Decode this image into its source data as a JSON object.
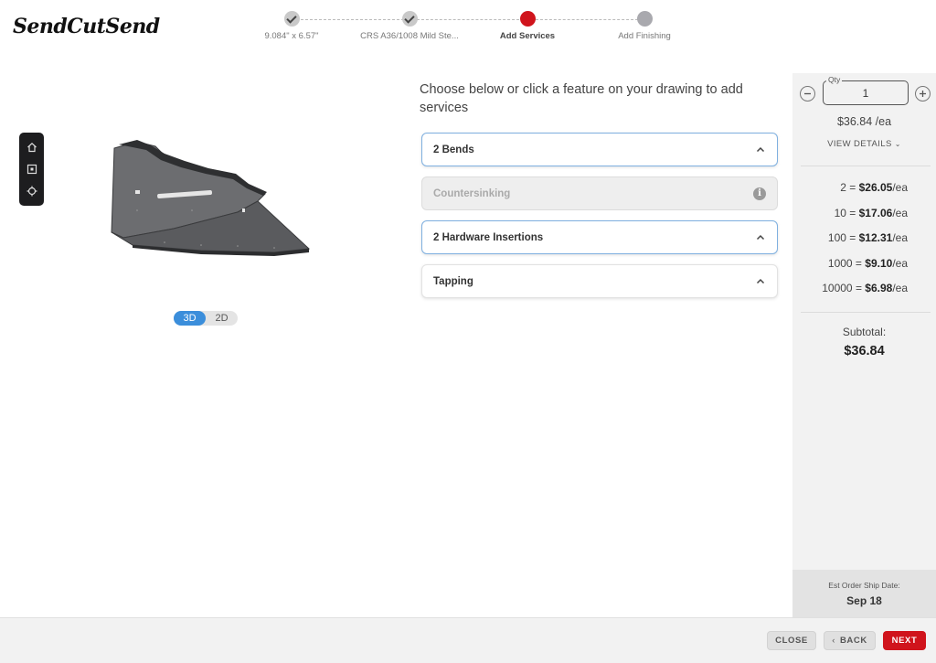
{
  "header": {
    "logo": "SendCutSend",
    "steps": [
      {
        "label": "9.084\" x 6.57\"",
        "state": "done"
      },
      {
        "label": "CRS A36/1008 Mild Ste...",
        "state": "done"
      },
      {
        "label": "Add Services",
        "state": "active"
      },
      {
        "label": "Add Finishing",
        "state": "todo"
      }
    ]
  },
  "viewer": {
    "toolbar": [
      "home-icon",
      "cube-front-icon",
      "fit-view-icon"
    ],
    "toggle": {
      "three_d": "3D",
      "two_d": "2D",
      "selected": "3D"
    }
  },
  "services": {
    "prompt": "Choose below or click a feature on your drawing to add services",
    "items": [
      {
        "label": "2 Bends",
        "state": "selected",
        "icon": "chevron-up-icon"
      },
      {
        "label": "Countersinking",
        "state": "disabled",
        "icon": "info-icon"
      },
      {
        "label": "2 Hardware Insertions",
        "state": "selected",
        "icon": "chevron-up-icon"
      },
      {
        "label": "Tapping",
        "state": "available",
        "icon": "chevron-up-icon"
      }
    ]
  },
  "pricing": {
    "qty_label": "Qty",
    "qty_value": "1",
    "unit_price": "$36.84 /ea",
    "view_details": "VIEW DETAILS",
    "tiers": [
      {
        "qty": "2 = ",
        "price": "$26.05",
        "unit": "/ea"
      },
      {
        "qty": "10 = ",
        "price": "$17.06",
        "unit": "/ea"
      },
      {
        "qty": "100 = ",
        "price": "$12.31",
        "unit": "/ea"
      },
      {
        "qty": "1000 = ",
        "price": "$9.10",
        "unit": "/ea"
      },
      {
        "qty": "10000 = ",
        "price": "$6.98",
        "unit": "/ea"
      }
    ],
    "subtotal_label": "Subtotal:",
    "subtotal": "$36.84",
    "ship_label": "Est Order Ship Date:",
    "ship_date": "Sep 18"
  },
  "footer": {
    "close": "CLOSE",
    "back": "BACK",
    "next": "NEXT"
  },
  "colors": {
    "accent_red": "#d0141c",
    "accent_blue": "#3b8edb",
    "selected_border": "#7fb0e0"
  }
}
